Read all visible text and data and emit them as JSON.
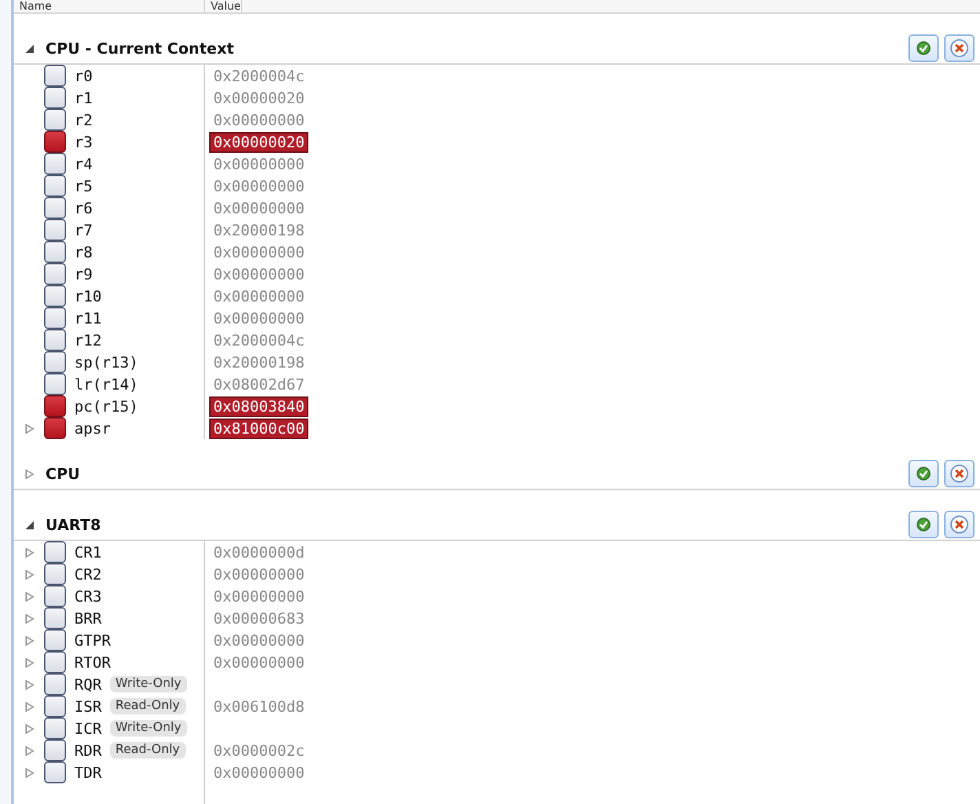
{
  "columns": [
    "Name",
    "Value"
  ],
  "sections": [
    {
      "title": "CPU - Current Context",
      "expanded": true,
      "registers": [
        {
          "name": "r0",
          "value": "0x2000004c",
          "changed": false,
          "expandable": false
        },
        {
          "name": "r1",
          "value": "0x00000020",
          "changed": false,
          "expandable": false
        },
        {
          "name": "r2",
          "value": "0x00000000",
          "changed": false,
          "expandable": false
        },
        {
          "name": "r3",
          "value": "0x00000020",
          "changed": true,
          "expandable": false
        },
        {
          "name": "r4",
          "value": "0x00000000",
          "changed": false,
          "expandable": false
        },
        {
          "name": "r5",
          "value": "0x00000000",
          "changed": false,
          "expandable": false
        },
        {
          "name": "r6",
          "value": "0x00000000",
          "changed": false,
          "expandable": false
        },
        {
          "name": "r7",
          "value": "0x20000198",
          "changed": false,
          "expandable": false
        },
        {
          "name": "r8",
          "value": "0x00000000",
          "changed": false,
          "expandable": false
        },
        {
          "name": "r9",
          "value": "0x00000000",
          "changed": false,
          "expandable": false
        },
        {
          "name": "r10",
          "value": "0x00000000",
          "changed": false,
          "expandable": false
        },
        {
          "name": "r11",
          "value": "0x00000000",
          "changed": false,
          "expandable": false
        },
        {
          "name": "r12",
          "value": "0x2000004c",
          "changed": false,
          "expandable": false
        },
        {
          "name": "sp(r13)",
          "value": "0x20000198",
          "changed": false,
          "expandable": false
        },
        {
          "name": "lr(r14)",
          "value": "0x08002d67",
          "changed": false,
          "expandable": false
        },
        {
          "name": "pc(r15)",
          "value": "0x08003840",
          "changed": true,
          "expandable": false
        },
        {
          "name": "apsr",
          "value": "0x81000c00",
          "changed": true,
          "expandable": true
        }
      ]
    },
    {
      "title": "CPU",
      "expanded": false
    },
    {
      "title": "UART8",
      "expanded": true,
      "registers": [
        {
          "name": "CR1",
          "value": "0x0000000d",
          "changed": false,
          "expandable": true
        },
        {
          "name": "CR2",
          "value": "0x00000000",
          "changed": false,
          "expandable": true
        },
        {
          "name": "CR3",
          "value": "0x00000000",
          "changed": false,
          "expandable": true
        },
        {
          "name": "BRR",
          "value": "0x00000683",
          "changed": false,
          "expandable": true
        },
        {
          "name": "GTPR",
          "value": "0x00000000",
          "changed": false,
          "expandable": true
        },
        {
          "name": "RTOR",
          "value": "0x00000000",
          "changed": false,
          "expandable": true
        },
        {
          "name": "RQR",
          "access": "Write-Only",
          "changed": false,
          "expandable": true
        },
        {
          "name": "ISR",
          "access": "Read-Only",
          "value": "0x006100d8",
          "changed": false,
          "expandable": true
        },
        {
          "name": "ICR",
          "access": "Write-Only",
          "changed": false,
          "expandable": true
        },
        {
          "name": "RDR",
          "access": "Read-Only",
          "value": "0x0000002c",
          "changed": false,
          "expandable": true
        },
        {
          "name": "TDR",
          "value": "0x00000000",
          "changed": false,
          "expandable": true
        }
      ]
    }
  ]
}
